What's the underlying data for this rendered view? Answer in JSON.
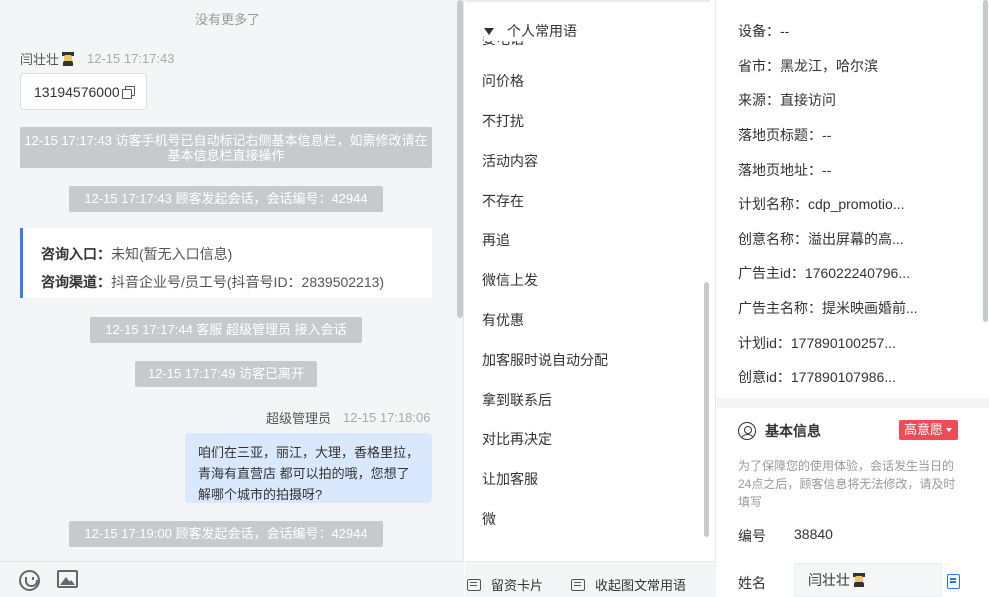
{
  "chat": {
    "no_more": "没有更多了",
    "visitor_name": "闫壮壮",
    "visitor_time": "12-15 17:17:43",
    "phone": "13194576000",
    "sys_autotag": "12-15 17:17:43 访客手机号已自动标记右侧基本信息栏，如需修改请在基本信息栏直接操作",
    "sys_start1": "12-15 17:17:43 顾客发起会话，会话编号：42944",
    "entry_label": "咨询入口：",
    "entry_value": "未知(暂无入口信息)",
    "channel_label": "咨询渠道：",
    "channel_value": "抖音企业号/员工号(抖音号ID：2839502213)",
    "sys_join": "12-15 17:17:44 客服 超级管理员 接入会话",
    "sys_leave": "12-15 17:17:49 访客已离开",
    "agent_name": "超级管理员",
    "agent_time": "12-15 17:18:06",
    "agent_msg": "咱们在三亚，丽江，大理，香格里拉，青海有直营店 都可以拍的哦，您想了解哪个城市的拍摄呀?",
    "sys_start2": "12-15 17:19:00 顾客发起会话，会话编号：42944"
  },
  "quick": {
    "header": "个人常用语",
    "cut_item": "要电话",
    "items": [
      "问价格",
      "不打扰",
      "活动内容",
      "不存在",
      "再追",
      "微信上发",
      "有优惠",
      "加客服时说自动分配",
      "拿到联系后",
      "对比再决定",
      "让加客服",
      "微"
    ],
    "footer_card": "留资卡片",
    "footer_collapse": "收起图文常用语"
  },
  "info": {
    "rows": [
      "设备：--",
      "省市：黑龙江，哈尔滨",
      "来源：直接访问",
      "落地页标题：--",
      "落地页地址：--",
      "计划名称：cdp_promotio...",
      "创意名称：溢出屏幕的高...",
      "广告主id：176022240796...",
      "广告主名称：提米映画婚前...",
      "计划id：177890100257...",
      "创意id：177890107986..."
    ],
    "basic_title": "基本信息",
    "intent": "高意愿",
    "notice": "为了保障您的使用体验，会话发生当日的24点之后，顾客信息将无法修改，请及时填写",
    "id_label": "编号",
    "id_value": "38840",
    "name_label": "姓名",
    "name_value": "闫壮壮"
  }
}
